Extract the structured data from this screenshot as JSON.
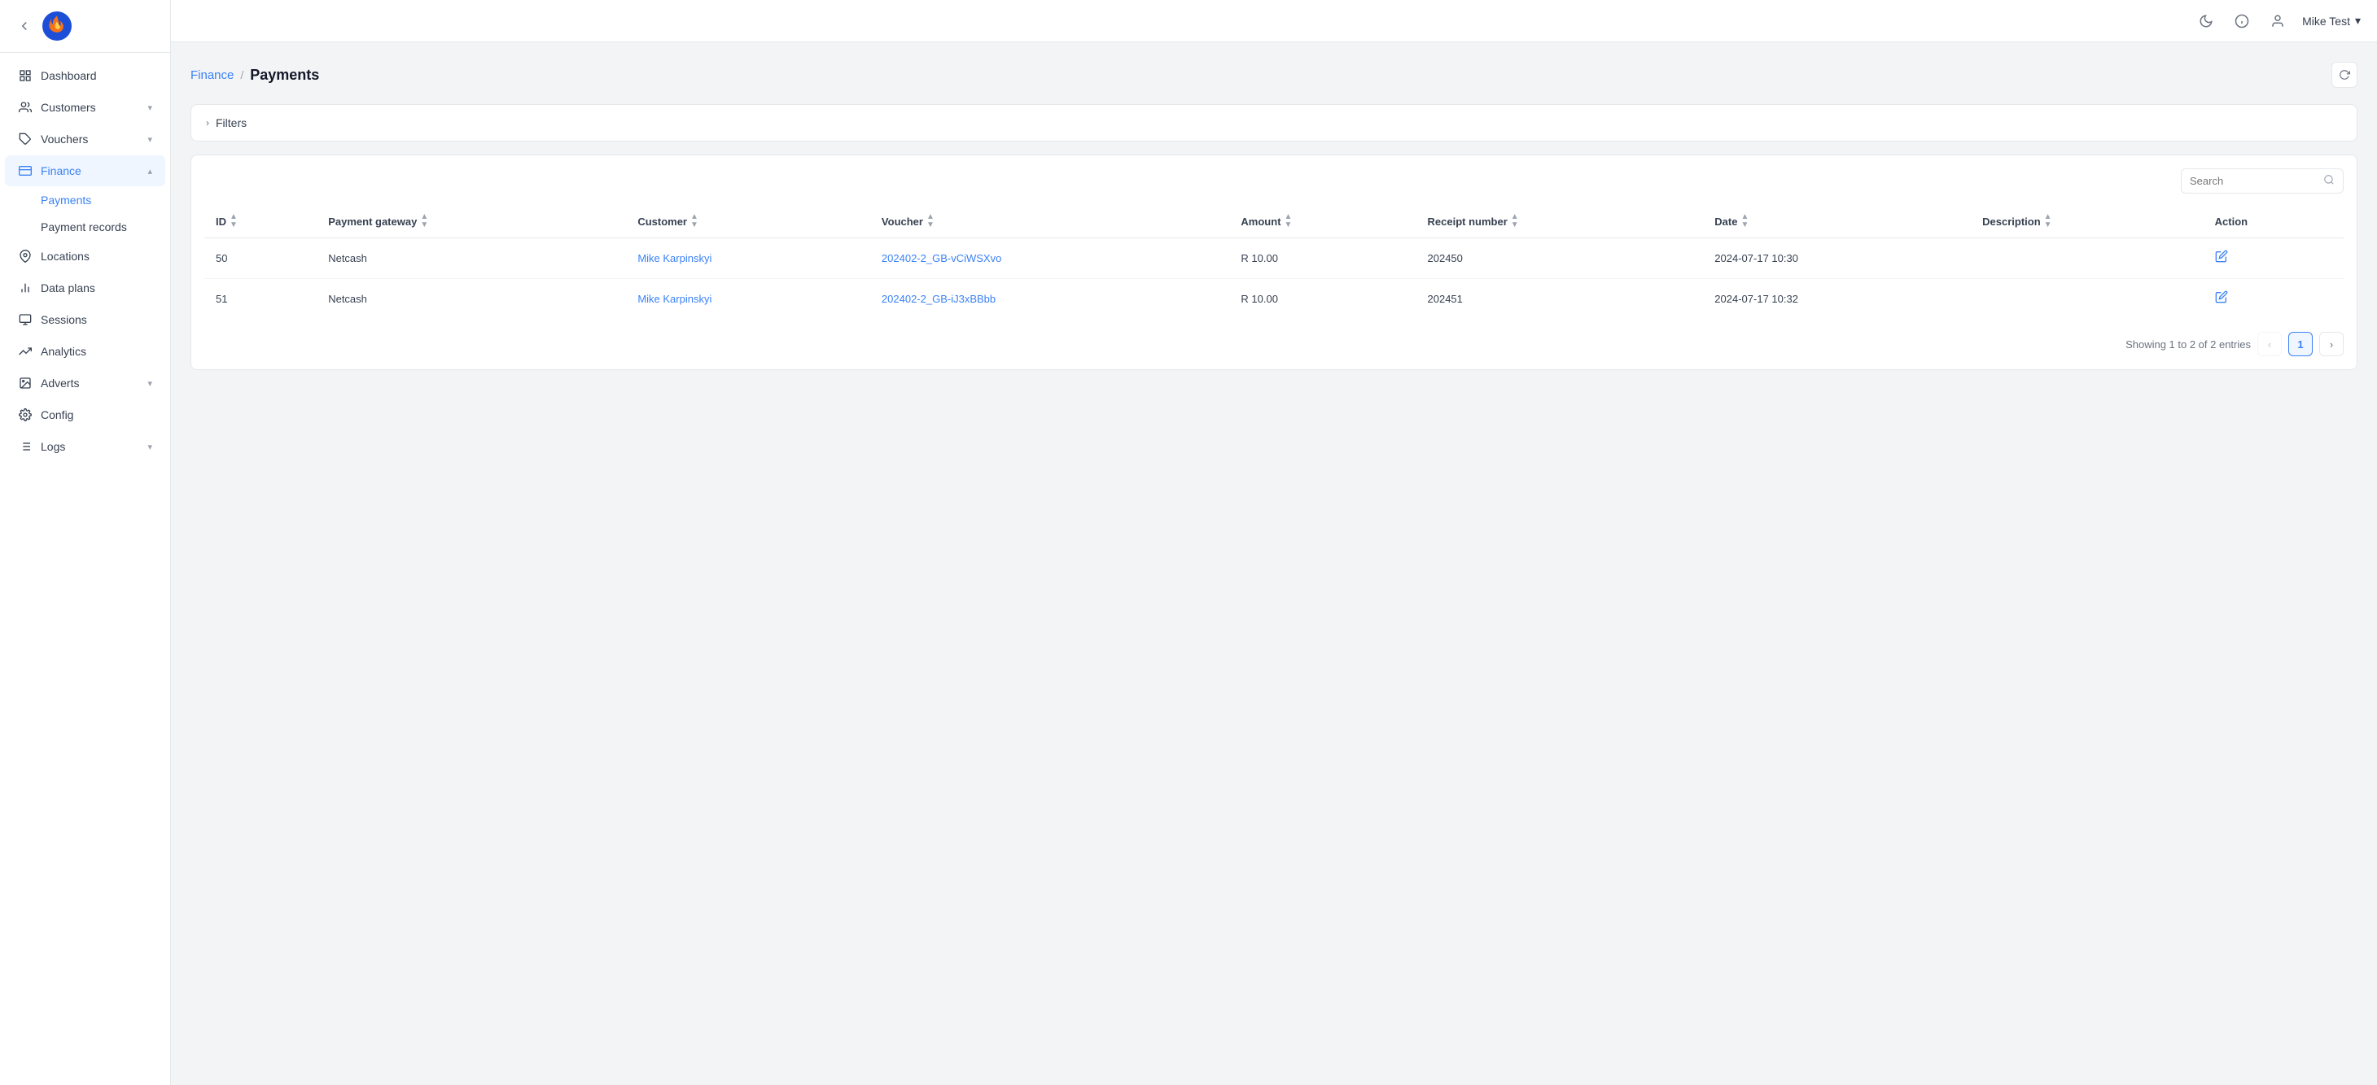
{
  "app": {
    "logo_alt": "App Logo"
  },
  "topbar": {
    "user_name": "Mike Test",
    "moon_icon": "🌙",
    "info_icon": "ⓘ",
    "user_icon": "👤"
  },
  "sidebar": {
    "items": [
      {
        "id": "dashboard",
        "label": "Dashboard",
        "icon": "grid",
        "active": false,
        "has_chevron": false
      },
      {
        "id": "customers",
        "label": "Customers",
        "icon": "users",
        "active": false,
        "has_chevron": true
      },
      {
        "id": "vouchers",
        "label": "Vouchers",
        "icon": "tag",
        "active": false,
        "has_chevron": true
      },
      {
        "id": "finance",
        "label": "Finance",
        "icon": "credit-card",
        "active": true,
        "has_chevron": true,
        "expanded": true
      },
      {
        "id": "locations",
        "label": "Locations",
        "icon": "map-pin",
        "active": false,
        "has_chevron": false
      },
      {
        "id": "data-plans",
        "label": "Data plans",
        "icon": "bar-chart",
        "active": false,
        "has_chevron": false
      },
      {
        "id": "sessions",
        "label": "Sessions",
        "icon": "monitor",
        "active": false,
        "has_chevron": false
      },
      {
        "id": "analytics",
        "label": "Analytics",
        "icon": "trending-up",
        "active": false,
        "has_chevron": false
      },
      {
        "id": "adverts",
        "label": "Adverts",
        "icon": "image",
        "active": false,
        "has_chevron": true
      },
      {
        "id": "config",
        "label": "Config",
        "icon": "settings",
        "active": false,
        "has_chevron": false
      },
      {
        "id": "logs",
        "label": "Logs",
        "icon": "list",
        "active": false,
        "has_chevron": true
      }
    ],
    "finance_sub": [
      {
        "id": "payments",
        "label": "Payments",
        "active": true
      },
      {
        "id": "payment-records",
        "label": "Payment records",
        "active": false
      }
    ]
  },
  "breadcrumb": {
    "parent": "Finance",
    "separator": "/",
    "current": "Payments"
  },
  "filters": {
    "label": "Filters",
    "chevron": "›"
  },
  "search": {
    "placeholder": "Search"
  },
  "table": {
    "columns": [
      {
        "id": "id",
        "label": "ID"
      },
      {
        "id": "payment_gateway",
        "label": "Payment gateway"
      },
      {
        "id": "customer",
        "label": "Customer"
      },
      {
        "id": "voucher",
        "label": "Voucher"
      },
      {
        "id": "amount",
        "label": "Amount"
      },
      {
        "id": "receipt_number",
        "label": "Receipt number"
      },
      {
        "id": "date",
        "label": "Date"
      },
      {
        "id": "description",
        "label": "Description"
      },
      {
        "id": "action",
        "label": "Action"
      }
    ],
    "rows": [
      {
        "id": "50",
        "payment_gateway": "Netcash",
        "customer": "Mike Karpinskyi",
        "customer_link": true,
        "voucher": "202402-2_GB-vCiWSXvo",
        "voucher_link": true,
        "amount": "R 10.00",
        "receipt_number": "202450",
        "date": "2024-07-17 10:30",
        "description": ""
      },
      {
        "id": "51",
        "payment_gateway": "Netcash",
        "customer": "Mike Karpinskyi",
        "customer_link": true,
        "voucher": "202402-2_GB-iJ3xBBbb",
        "voucher_link": true,
        "amount": "R 10.00",
        "receipt_number": "202451",
        "date": "2024-07-17 10:32",
        "description": ""
      }
    ]
  },
  "pagination": {
    "text": "Showing 1 to 2 of 2 entries",
    "current_page": "1"
  }
}
